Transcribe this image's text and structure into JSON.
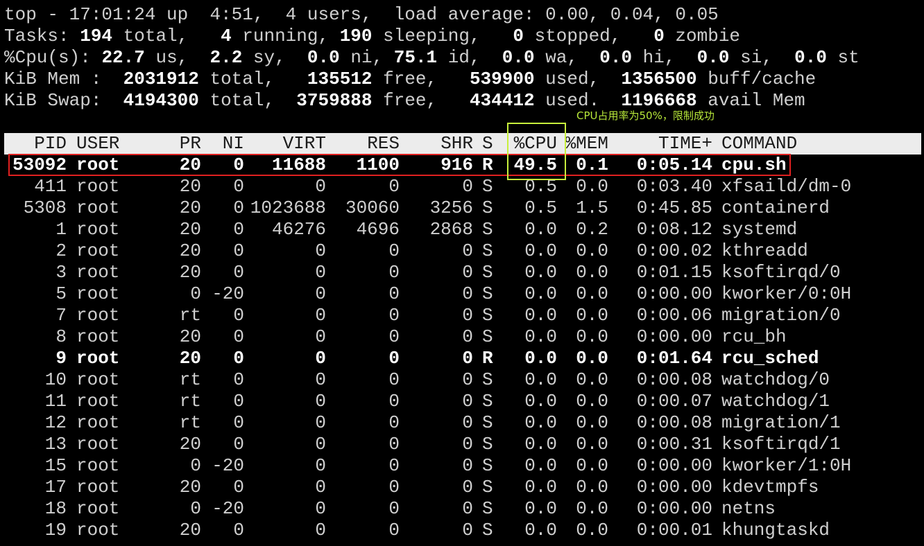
{
  "summary": {
    "line1": "top - 17:01:24 up  4:51,  4 users,  load average: 0.00, 0.04, 0.05",
    "tasks": {
      "prefix": "Tasks: ",
      "total": "194",
      "t1": " total,   ",
      "running": "4",
      "t2": " running, ",
      "sleeping": "190",
      "t3": " sleeping,   ",
      "stopped": "0",
      "t4": " stopped,   ",
      "zombie": "0",
      "t5": " zombie"
    },
    "cpu": {
      "prefix": "%Cpu(s): ",
      "us": "22.7",
      "t1": " us,  ",
      "sy": "2.2",
      "t2": " sy,  ",
      "ni": "0.0",
      "t3": " ni, ",
      "id": "75.1",
      "t4": " id,  ",
      "wa": "0.0",
      "t5": " wa,  ",
      "hi": "0.0",
      "t6": " hi,  ",
      "si": "0.0",
      "t7": " si,  ",
      "st": "0.0",
      "t8": " st"
    },
    "mem": {
      "prefix": "KiB Mem :  ",
      "total": "2031912",
      "t1": " total,   ",
      "free": "135512",
      "t2": " free,   ",
      "used": "539900",
      "t3": " used,  ",
      "buff": "1356500",
      "t4": " buff/cache"
    },
    "swap": {
      "prefix": "KiB Swap:  ",
      "total": "4194300",
      "t1": " total,  ",
      "free": "3759888",
      "t2": " free,   ",
      "used": "434412",
      "t3": " used.  ",
      "avail": "1196668",
      "t4": " avail Mem"
    }
  },
  "annotation": "CPU占用率为50%，限制成功",
  "columns": {
    "pid": "PID",
    "user": "USER",
    "pr": "PR",
    "ni": "NI",
    "virt": "VIRT",
    "res": "RES",
    "shr": "SHR",
    "s": "S",
    "cpu": "%CPU",
    "mem": "%MEM",
    "time": "TIME+",
    "command": "COMMAND"
  },
  "processes": [
    {
      "pid": "53092",
      "user": "root",
      "pr": "20",
      "ni": "0",
      "virt": "11688",
      "res": "1100",
      "shr": "916",
      "s": "R",
      "cpu": "49.5",
      "mem": "0.1",
      "time": "0:05.14",
      "command": "cpu.sh"
    },
    {
      "pid": "411",
      "user": "root",
      "pr": "20",
      "ni": "0",
      "virt": "0",
      "res": "0",
      "shr": "0",
      "s": "S",
      "cpu": "0.5",
      "mem": "0.0",
      "time": "0:03.40",
      "command": "xfsaild/dm-0"
    },
    {
      "pid": "5308",
      "user": "root",
      "pr": "20",
      "ni": "0",
      "virt": "1023688",
      "res": "30060",
      "shr": "3256",
      "s": "S",
      "cpu": "0.5",
      "mem": "1.5",
      "time": "0:45.85",
      "command": "containerd"
    },
    {
      "pid": "1",
      "user": "root",
      "pr": "20",
      "ni": "0",
      "virt": "46276",
      "res": "4696",
      "shr": "2868",
      "s": "S",
      "cpu": "0.0",
      "mem": "0.2",
      "time": "0:08.12",
      "command": "systemd"
    },
    {
      "pid": "2",
      "user": "root",
      "pr": "20",
      "ni": "0",
      "virt": "0",
      "res": "0",
      "shr": "0",
      "s": "S",
      "cpu": "0.0",
      "mem": "0.0",
      "time": "0:00.02",
      "command": "kthreadd"
    },
    {
      "pid": "3",
      "user": "root",
      "pr": "20",
      "ni": "0",
      "virt": "0",
      "res": "0",
      "shr": "0",
      "s": "S",
      "cpu": "0.0",
      "mem": "0.0",
      "time": "0:01.15",
      "command": "ksoftirqd/0"
    },
    {
      "pid": "5",
      "user": "root",
      "pr": "0",
      "ni": "-20",
      "virt": "0",
      "res": "0",
      "shr": "0",
      "s": "S",
      "cpu": "0.0",
      "mem": "0.0",
      "time": "0:00.00",
      "command": "kworker/0:0H"
    },
    {
      "pid": "7",
      "user": "root",
      "pr": "rt",
      "ni": "0",
      "virt": "0",
      "res": "0",
      "shr": "0",
      "s": "S",
      "cpu": "0.0",
      "mem": "0.0",
      "time": "0:00.06",
      "command": "migration/0"
    },
    {
      "pid": "8",
      "user": "root",
      "pr": "20",
      "ni": "0",
      "virt": "0",
      "res": "0",
      "shr": "0",
      "s": "S",
      "cpu": "0.0",
      "mem": "0.0",
      "time": "0:00.00",
      "command": "rcu_bh"
    },
    {
      "pid": "9",
      "user": "root",
      "pr": "20",
      "ni": "0",
      "virt": "0",
      "res": "0",
      "shr": "0",
      "s": "R",
      "cpu": "0.0",
      "mem": "0.0",
      "time": "0:01.64",
      "command": "rcu_sched"
    },
    {
      "pid": "10",
      "user": "root",
      "pr": "rt",
      "ni": "0",
      "virt": "0",
      "res": "0",
      "shr": "0",
      "s": "S",
      "cpu": "0.0",
      "mem": "0.0",
      "time": "0:00.08",
      "command": "watchdog/0"
    },
    {
      "pid": "11",
      "user": "root",
      "pr": "rt",
      "ni": "0",
      "virt": "0",
      "res": "0",
      "shr": "0",
      "s": "S",
      "cpu": "0.0",
      "mem": "0.0",
      "time": "0:00.07",
      "command": "watchdog/1"
    },
    {
      "pid": "12",
      "user": "root",
      "pr": "rt",
      "ni": "0",
      "virt": "0",
      "res": "0",
      "shr": "0",
      "s": "S",
      "cpu": "0.0",
      "mem": "0.0",
      "time": "0:00.08",
      "command": "migration/1"
    },
    {
      "pid": "13",
      "user": "root",
      "pr": "20",
      "ni": "0",
      "virt": "0",
      "res": "0",
      "shr": "0",
      "s": "S",
      "cpu": "0.0",
      "mem": "0.0",
      "time": "0:00.31",
      "command": "ksoftirqd/1"
    },
    {
      "pid": "15",
      "user": "root",
      "pr": "0",
      "ni": "-20",
      "virt": "0",
      "res": "0",
      "shr": "0",
      "s": "S",
      "cpu": "0.0",
      "mem": "0.0",
      "time": "0:00.00",
      "command": "kworker/1:0H"
    },
    {
      "pid": "17",
      "user": "root",
      "pr": "20",
      "ni": "0",
      "virt": "0",
      "res": "0",
      "shr": "0",
      "s": "S",
      "cpu": "0.0",
      "mem": "0.0",
      "time": "0:00.00",
      "command": "kdevtmpfs"
    },
    {
      "pid": "18",
      "user": "root",
      "pr": "0",
      "ni": "-20",
      "virt": "0",
      "res": "0",
      "shr": "0",
      "s": "S",
      "cpu": "0.0",
      "mem": "0.0",
      "time": "0:00.00",
      "command": "netns"
    },
    {
      "pid": "19",
      "user": "root",
      "pr": "20",
      "ni": "0",
      "virt": "0",
      "res": "0",
      "shr": "0",
      "s": "S",
      "cpu": "0.0",
      "mem": "0.0",
      "time": "0:00.01",
      "command": "khungtaskd"
    }
  ],
  "styles": {
    "background": "#000000",
    "text": "#cfcfcf",
    "bold_text": "#ffffff",
    "header_bar": "#ececec",
    "red_box": "#e02020",
    "green_box": "#c8f03c",
    "annotation_color": "#b8e83a"
  }
}
